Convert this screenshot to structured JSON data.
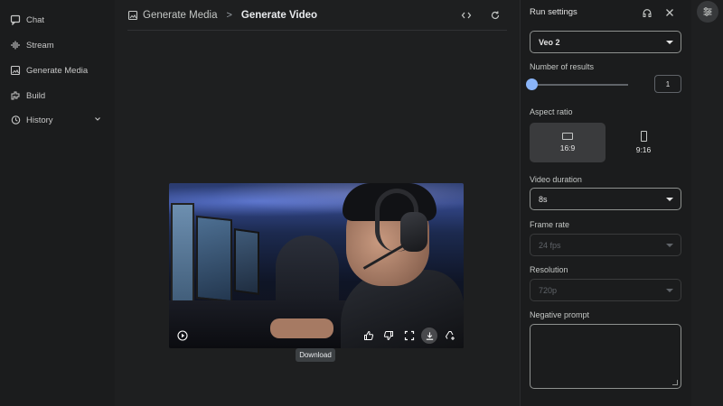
{
  "sidebar": {
    "items": [
      {
        "label": "Chat",
        "icon": "chat-icon"
      },
      {
        "label": "Stream",
        "icon": "stream-icon"
      },
      {
        "label": "Generate Media",
        "icon": "image-icon"
      },
      {
        "label": "Build",
        "icon": "build-icon"
      },
      {
        "label": "History",
        "icon": "history-icon"
      }
    ]
  },
  "header": {
    "breadcrumb_parent": "Generate Media",
    "separator": ">",
    "breadcrumb_current": "Generate Video"
  },
  "video": {
    "tooltip": "Download",
    "controls": [
      "play-icon",
      "thumbs-up-icon",
      "thumbs-down-icon",
      "fullscreen-icon",
      "download-icon",
      "add-to-drive-icon"
    ]
  },
  "settings": {
    "title": "Run settings",
    "model": "Veo 2",
    "number_of_results_label": "Number of results",
    "number_of_results": "1",
    "aspect_ratio_label": "Aspect ratio",
    "aspect_options": [
      "16:9",
      "9:16"
    ],
    "aspect_selected": "16:9",
    "video_duration_label": "Video duration",
    "video_duration": "8s",
    "frame_rate_label": "Frame rate",
    "frame_rate": "24 fps",
    "resolution_label": "Resolution",
    "resolution": "720p",
    "negative_prompt_label": "Negative prompt",
    "negative_prompt": ""
  },
  "colors": {
    "background": "#1e1f20",
    "panel": "#1b1c1d",
    "accent": "#8ab4f8"
  }
}
